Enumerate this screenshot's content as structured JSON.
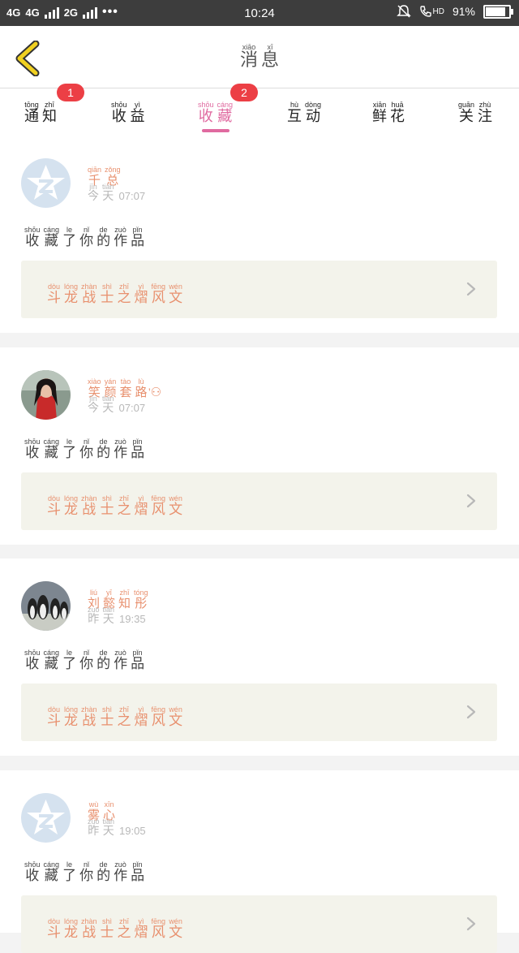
{
  "status_bar": {
    "network1": "4G",
    "network2": "4G",
    "network3": "2G",
    "dots": "•••",
    "time": "10:24",
    "hd": "HD",
    "battery_percent": "91%",
    "battery_level": 0.91
  },
  "header": {
    "title": [
      {
        "py": "xiāo",
        "hz": "消"
      },
      {
        "py": "xī",
        "hz": "息"
      }
    ]
  },
  "tabs": [
    {
      "chars": [
        {
          "py": "tōng",
          "hz": "通"
        },
        {
          "py": "zhī",
          "hz": "知"
        }
      ],
      "badge": "1"
    },
    {
      "chars": [
        {
          "py": "shōu",
          "hz": "收"
        },
        {
          "py": "yì",
          "hz": "益"
        }
      ]
    },
    {
      "chars": [
        {
          "py": "shōu",
          "hz": "收"
        },
        {
          "py": "cáng",
          "hz": "藏"
        }
      ],
      "badge": "2",
      "active": true
    },
    {
      "chars": [
        {
          "py": "hù",
          "hz": "互"
        },
        {
          "py": "dòng",
          "hz": "动"
        }
      ]
    },
    {
      "chars": [
        {
          "py": "xiān",
          "hz": "鲜"
        },
        {
          "py": "huā",
          "hz": "花"
        }
      ]
    },
    {
      "chars": [
        {
          "py": "guān",
          "hz": "关"
        },
        {
          "py": "zhù",
          "hz": "注"
        }
      ]
    }
  ],
  "action_text": [
    {
      "py": "shōu",
      "hz": "收"
    },
    {
      "py": "cáng",
      "hz": "藏"
    },
    {
      "py": "le",
      "hz": "了"
    },
    {
      "py": "nǐ",
      "hz": "你"
    },
    {
      "py": "de",
      "hz": "的"
    },
    {
      "py": "zuò",
      "hz": "作"
    },
    {
      "py": "pǐn",
      "hz": "品"
    }
  ],
  "work_title": [
    {
      "py": "dòu",
      "hz": "斗"
    },
    {
      "py": "lóng",
      "hz": "龙"
    },
    {
      "py": "zhàn",
      "hz": "战"
    },
    {
      "py": "shì",
      "hz": "士"
    },
    {
      "py": "zhī",
      "hz": "之"
    },
    {
      "py": "yì",
      "hz": "熠"
    },
    {
      "py": "fēng",
      "hz": "风"
    },
    {
      "py": "wén",
      "hz": "文"
    }
  ],
  "messages": [
    {
      "name": [
        {
          "py": "qiān",
          "hz": "千"
        },
        {
          "py": "zǒng",
          "hz": "总"
        }
      ],
      "day": [
        {
          "py": "jīn",
          "hz": "今"
        },
        {
          "py": "tiān",
          "hz": "天"
        }
      ],
      "clock": "07:07",
      "avatar": "default"
    },
    {
      "name": [
        {
          "py": "xiào",
          "hz": "笑"
        },
        {
          "py": "yán",
          "hz": "颜"
        },
        {
          "py": "tào",
          "hz": "套"
        },
        {
          "py": "lù",
          "hz": "路"
        },
        {
          "py": "",
          "hz": "ᡃ⚇"
        }
      ],
      "day": [
        {
          "py": "jīn",
          "hz": "今"
        },
        {
          "py": "tiān",
          "hz": "天"
        }
      ],
      "clock": "07:07",
      "avatar": "girl"
    },
    {
      "name": [
        {
          "py": "liú",
          "hz": "刘"
        },
        {
          "py": "yī",
          "hz": "懿"
        },
        {
          "py": "zhī",
          "hz": "知"
        },
        {
          "py": "tóng",
          "hz": "彤"
        }
      ],
      "day": [
        {
          "py": "zuó",
          "hz": "昨"
        },
        {
          "py": "tiān",
          "hz": "天"
        }
      ],
      "clock": "19:35",
      "avatar": "penguins"
    },
    {
      "name": [
        {
          "py": "wù",
          "hz": "雾"
        },
        {
          "py": "xīn",
          "hz": "心"
        }
      ],
      "day": [
        {
          "py": "zuó",
          "hz": "昨"
        },
        {
          "py": "tiān",
          "hz": "天"
        }
      ],
      "clock": "19:05",
      "avatar": "default"
    }
  ],
  "colors": {
    "accent": "#e06aa0",
    "badge": "#ec3f45",
    "name": "#e8906e",
    "back_icon": "#f0d020"
  }
}
